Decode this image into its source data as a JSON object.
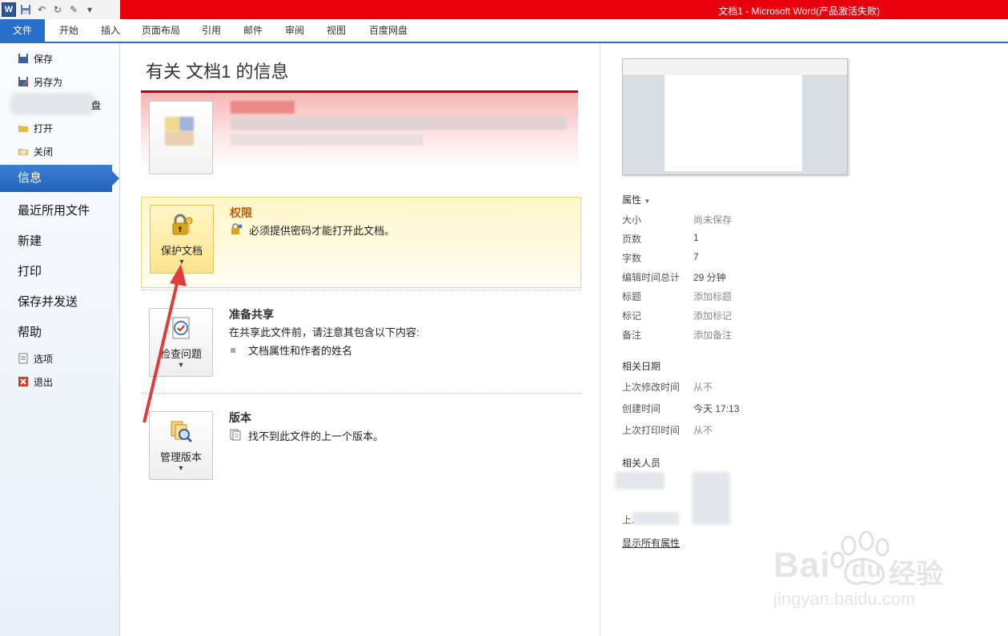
{
  "titlebar": {
    "word_logo": "W",
    "title": "文档1 - Microsoft Word(产品激活失败)",
    "qat_icons": [
      "save-icon",
      "undo-icon",
      "redo-icon",
      "spelling-icon",
      "customize-icon"
    ]
  },
  "ribbon": {
    "file_tab": "文件",
    "tabs": [
      "开始",
      "插入",
      "页面布局",
      "引用",
      "邮件",
      "审阅",
      "视图",
      "百度网盘"
    ],
    "accent_color": "#2a6fc9",
    "title_color": "#e8000d"
  },
  "nav": {
    "save": "保存",
    "save_as": "另存为",
    "obscured_suffix": "盘",
    "open": "打开",
    "close": "关闭",
    "info": "信息",
    "recent": "最近所用文件",
    "new": "新建",
    "print": "打印",
    "save_send": "保存并发送",
    "help": "帮助",
    "options": "选项",
    "exit": "退出"
  },
  "main": {
    "title": "有关 文档1 的信息",
    "permissions": {
      "button_label": "保护文档",
      "title": "权限",
      "description": "必须提供密码才能打开此文档。"
    },
    "prepare": {
      "button_label": "检查问题",
      "title": "准备共享",
      "description": "在共享此文件前，请注意其包含以下内容:",
      "bullet": "文档属性和作者的姓名"
    },
    "versions": {
      "button_label": "管理版本",
      "title": "版本",
      "description": "找不到此文件的上一个版本。"
    }
  },
  "properties": {
    "heading": "属性",
    "rows": [
      {
        "label": "大小",
        "value": "尚未保存",
        "muted": true
      },
      {
        "label": "页数",
        "value": "1",
        "muted": false
      },
      {
        "label": "字数",
        "value": "7",
        "muted": false
      },
      {
        "label": "编辑时间总计",
        "value": "29 分钟",
        "muted": false
      },
      {
        "label": "标题",
        "value": "添加标题",
        "muted": true
      },
      {
        "label": "标记",
        "value": "添加标记",
        "muted": true
      },
      {
        "label": "备注",
        "value": "添加备注",
        "muted": true
      }
    ]
  },
  "dates": {
    "heading": "相关日期",
    "rows": [
      {
        "label": "上次修改时间",
        "value": "从不",
        "muted": true
      },
      {
        "label": "创建时间",
        "value": "今天 17:13",
        "muted": false
      },
      {
        "label": "上次打印时间",
        "value": "从不",
        "muted": true
      }
    ]
  },
  "people": {
    "heading": "相关人员",
    "obscured_prefix": "上.",
    "show_all": "显示所有属性"
  },
  "watermark": {
    "brand": "Bai",
    "brand2": "du",
    "cn": "经验",
    "url": "jingyan.baidu.com"
  }
}
